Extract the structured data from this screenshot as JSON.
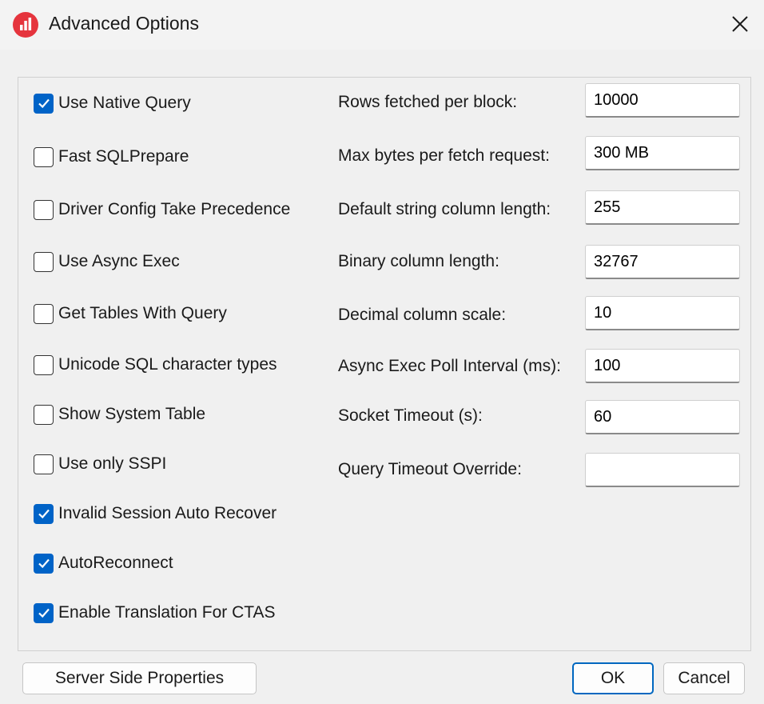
{
  "window": {
    "title": "Advanced Options",
    "app_icon": "bar-chart-logo-icon",
    "close_icon": "close-icon",
    "accent_color": "#0063c7",
    "logo_color": "#e5343d"
  },
  "checkboxes": [
    {
      "label": "Use Native Query",
      "checked": true
    },
    {
      "label": "Fast SQLPrepare",
      "checked": false
    },
    {
      "label": "Driver Config Take Precedence",
      "checked": false
    },
    {
      "label": "Use Async Exec",
      "checked": false
    },
    {
      "label": "Get Tables With Query",
      "checked": false
    },
    {
      "label": "Unicode SQL character types",
      "checked": false
    },
    {
      "label": "Show System Table",
      "checked": false
    },
    {
      "label": "Use only SSPI",
      "checked": false
    },
    {
      "label": "Invalid Session Auto Recover",
      "checked": true
    },
    {
      "label": "AutoReconnect",
      "checked": true
    },
    {
      "label": "Enable Translation For CTAS",
      "checked": true
    }
  ],
  "fields": [
    {
      "label": "Rows fetched per block:",
      "value": "10000"
    },
    {
      "label": "Max bytes per fetch request:",
      "value": "300 MB"
    },
    {
      "label": "Default string column length:",
      "value": "255"
    },
    {
      "label": "Binary column length:",
      "value": "32767"
    },
    {
      "label": "Decimal column scale:",
      "value": "10"
    },
    {
      "label": "Async Exec Poll Interval (ms):",
      "value": "100"
    },
    {
      "label": "Socket Timeout (s):",
      "value": "60"
    },
    {
      "label": "Query Timeout Override:",
      "value": ""
    }
  ],
  "buttons": {
    "server_side_properties": "Server Side Properties",
    "ok": "OK",
    "cancel": "Cancel"
  }
}
